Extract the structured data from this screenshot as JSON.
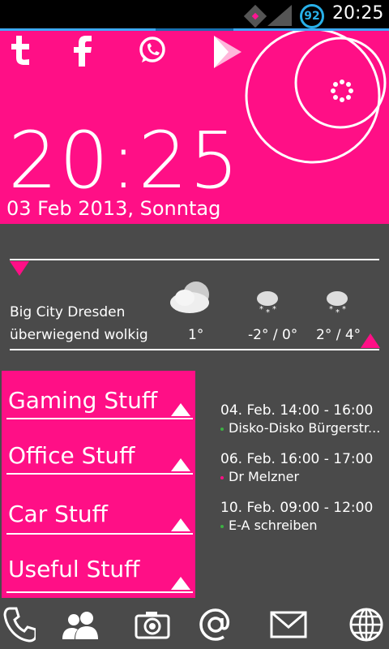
{
  "status_bar": {
    "battery_level": "92",
    "time": "20:25"
  },
  "clock": {
    "time": "20:25",
    "date": "03 Feb 2013, Sonntag"
  },
  "social_icons": [
    {
      "name": "tumblr-icon",
      "glyph": "t"
    },
    {
      "name": "facebook-icon",
      "glyph": "f"
    },
    {
      "name": "whatsapp-icon",
      "glyph": ""
    },
    {
      "name": "play-store-icon",
      "glyph": ""
    }
  ],
  "weather": {
    "location": "Big City Dresden",
    "condition": "überwiegend wolkig",
    "forecast": [
      {
        "icon": "cloud-sun-icon",
        "temp": "1°"
      },
      {
        "icon": "snow-cloud-icon",
        "temp": "-2° / 0°"
      },
      {
        "icon": "snow-cloud-icon",
        "temp": "2°  / 4°"
      }
    ]
  },
  "menu": [
    {
      "label": "Gaming Stuff"
    },
    {
      "label": "Office Stuff"
    },
    {
      "label": "Car Stuff"
    },
    {
      "label": "Useful Stuff"
    }
  ],
  "agenda": [
    {
      "date": "04. Feb.   14:00 - 16:00",
      "title": "Disko-Disko Bürgerstr...",
      "dot_color": "#3cb043"
    },
    {
      "date": "06. Feb.   16:00 - 17:00",
      "title": "Dr Melzner",
      "dot_color": "#ff0f86"
    },
    {
      "date": "10. Feb.   09:00 - 12:00",
      "title": "E-A schreiben",
      "dot_color": "#3cb043"
    }
  ],
  "dock": [
    {
      "icon": "phone-icon"
    },
    {
      "icon": "contacts-icon"
    },
    {
      "icon": "camera-icon"
    },
    {
      "icon": "at-icon"
    },
    {
      "icon": "mail-icon"
    },
    {
      "icon": "globe-icon"
    }
  ],
  "colors": {
    "accent": "#ff0f86",
    "background": "#4a4a4a",
    "battery": "#28b0e8"
  }
}
